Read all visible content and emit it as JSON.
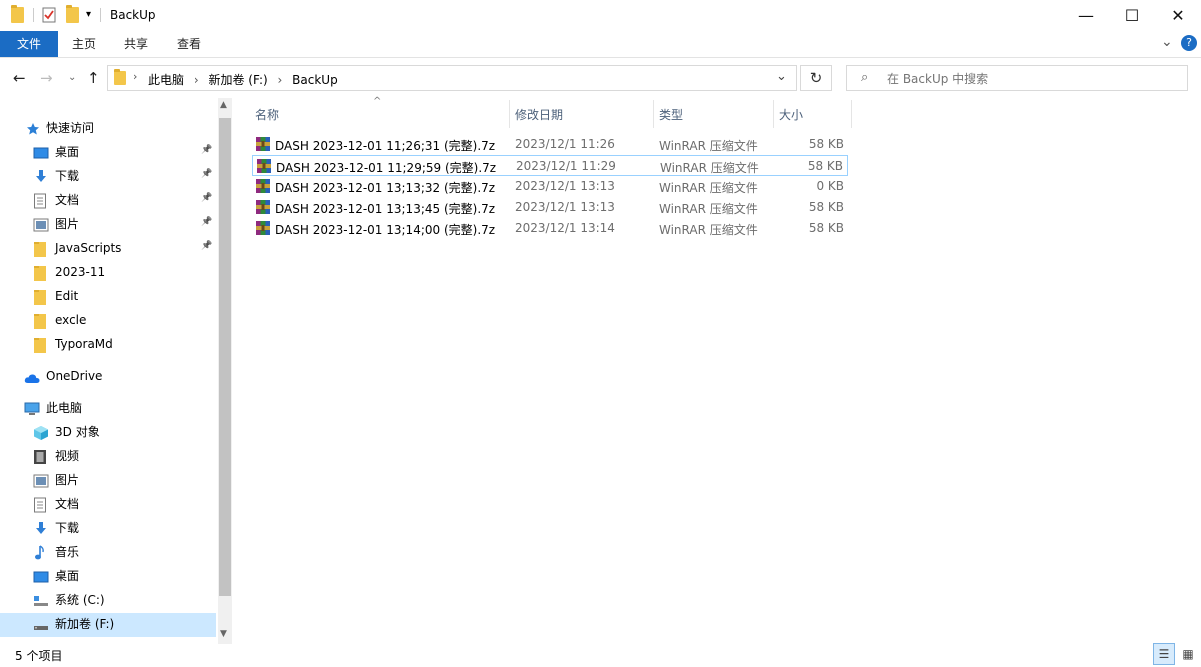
{
  "window": {
    "title": "BackUp",
    "minimize": "—",
    "maximize": "☐",
    "close": "✕"
  },
  "ribbon": {
    "tabs": [
      "文件",
      "主页",
      "共享",
      "查看"
    ],
    "expand": "⌄",
    "help": "?"
  },
  "address": {
    "crumbs": [
      "此电脑",
      "新加卷 (F:)",
      "BackUp"
    ]
  },
  "search": {
    "placeholder": "在 BackUp 中搜索"
  },
  "nav": {
    "quick_access": "快速访问",
    "quick_items": [
      "桌面",
      "下载",
      "文档",
      "图片",
      "JavaScripts",
      "2023-11",
      "Edit",
      "excle",
      "TyporaMd"
    ],
    "onedrive": "OneDrive",
    "this_pc": "此电脑",
    "pc_items": [
      "3D 对象",
      "视频",
      "图片",
      "文档",
      "下载",
      "音乐",
      "桌面",
      "系统 (C:)",
      "新加卷 (F:)"
    ]
  },
  "columns": {
    "name": "名称",
    "date": "修改日期",
    "type": "类型",
    "size": "大小"
  },
  "files": [
    {
      "name": "DASH 2023-12-01 11;26;31 (完整).7z",
      "date": "2023/12/1 11:26",
      "type": "WinRAR 压缩文件",
      "size": "58 KB"
    },
    {
      "name": "DASH 2023-12-01 11;29;59 (完整).7z",
      "date": "2023/12/1 11:29",
      "type": "WinRAR 压缩文件",
      "size": "58 KB"
    },
    {
      "name": "DASH 2023-12-01 13;13;32 (完整).7z",
      "date": "2023/12/1 13:13",
      "type": "WinRAR 压缩文件",
      "size": "0 KB"
    },
    {
      "name": "DASH 2023-12-01 13;13;45 (完整).7z",
      "date": "2023/12/1 13:13",
      "type": "WinRAR 压缩文件",
      "size": "58 KB"
    },
    {
      "name": "DASH 2023-12-01 13;14;00 (完整).7z",
      "date": "2023/12/1 13:14",
      "type": "WinRAR 压缩文件",
      "size": "58 KB"
    }
  ],
  "status": {
    "count": "5 个项目"
  },
  "colors": {
    "accent": "#1b6cc4",
    "selection": "#cce8ff",
    "folder": "#f3c64a"
  }
}
